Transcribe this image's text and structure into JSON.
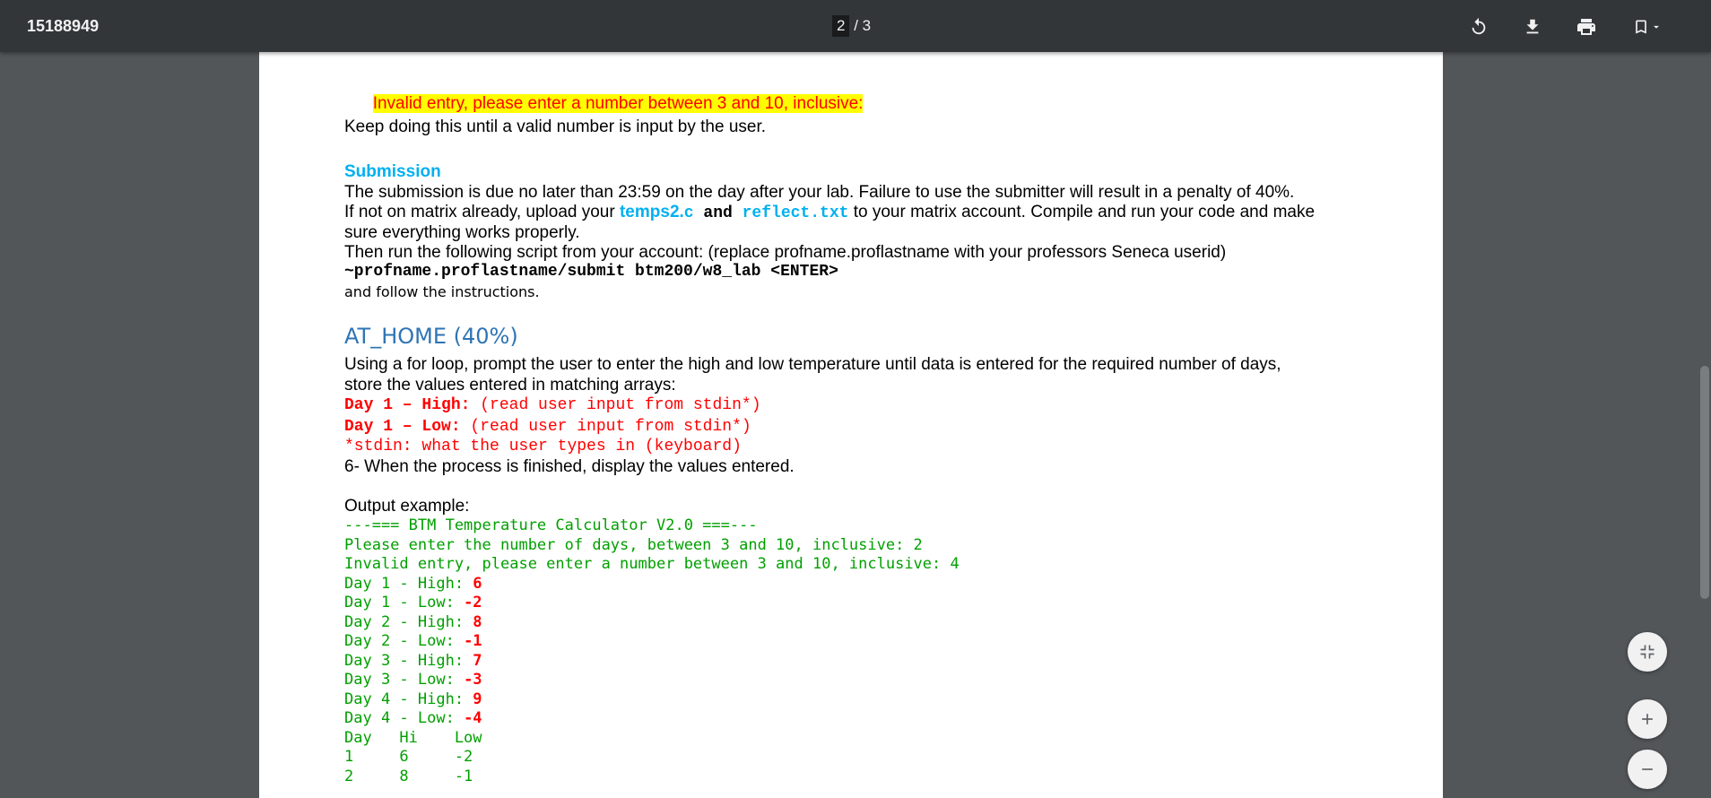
{
  "toolbar": {
    "title": "15188949",
    "page_current": "2",
    "page_total": "/ 3",
    "icons": [
      "rotate-icon",
      "download-icon",
      "print-icon",
      "bookmark-icon",
      "chevron-down-icon"
    ]
  },
  "doc": {
    "invalid_line": "Invalid entry, please enter a number between 3 and 10, inclusive:",
    "keep_line": "Keep doing this until a valid number is input by the user.",
    "submission_heading": "Submission",
    "sub_line1": "The submission is due no later than 23:59 on the day after your lab. Failure to use the submitter will result in a penalty of 40%.",
    "sub_line2_a": "If not on matrix already, upload your ",
    "sub_line2_file1": "temps2.",
    "sub_line2_file1b": "c",
    "sub_line2_and": " and ",
    "sub_line2_file2": "reflect.txt",
    "sub_line2_b": " to your matrix account. Compile and run your code and make",
    "sub_line3": "sure everything works properly.",
    "sub_line4": "Then run the following script from your account: (replace profname.proflastname with your professors Seneca userid)",
    "sub_cmd": "~profname.proflastname/submit btm200/w8_lab <ENTER>",
    "sub_follow": "and follow the instructions.",
    "athome_heading": "AT_HOME (40%)",
    "ah_line1": "Using a for loop, prompt the user to enter the high and low temperature until data is entered for the required number of days,",
    "ah_line2": "store the values entered in matching arrays:",
    "ah_day1high_label": "Day 1 – High:",
    "ah_day1high_note": " (read user input from stdin*)",
    "ah_day1low_label": "Day 1 – Low:",
    "ah_day1low_note": " (read user input from stdin*)",
    "ah_stdin": "*stdin: what the user types in (keyboard)",
    "ah_step6": "6- When the process is finished, display the values entered.",
    "output_label": "Output example:",
    "out_title": "---=== BTM Temperature Calculator V2.0 ===---",
    "out_prompt": "Please enter the number of days, between 3 and 10, inclusive: 2",
    "out_invalid": "Invalid entry, please enter a number between 3 and 10, inclusive: 4",
    "out_rows": [
      {
        "label": "Day 1 - High: ",
        "value": "6"
      },
      {
        "label": "Day 1 - Low: ",
        "value": "-2"
      },
      {
        "label": "Day 2 - High: ",
        "value": "8"
      },
      {
        "label": "Day 2 - Low: ",
        "value": "-1"
      },
      {
        "label": "Day 3 - High: ",
        "value": "7"
      },
      {
        "label": "Day 3 - Low: ",
        "value": "-3"
      },
      {
        "label": "Day 4 - High: ",
        "value": "9"
      },
      {
        "label": "Day 4 - Low: ",
        "value": "-4"
      }
    ],
    "out_table_header": "Day   Hi    Low",
    "out_table_rows": [
      "1     6     -2",
      "2     8     -1"
    ]
  },
  "fabs": [
    "fit-page-icon",
    "zoom-in-icon",
    "zoom-out-icon"
  ]
}
